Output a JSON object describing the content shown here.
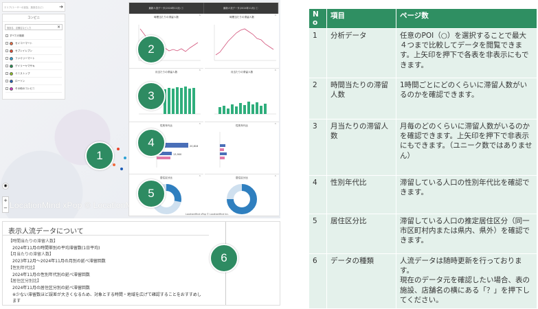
{
  "left": {
    "search_placeholder": "エリア(ユーザーの追加、施設名など)",
    "filter": {
      "title": "コンビニ",
      "search_placeholder": "施設名、店舗名など入力",
      "items": [
        {
          "label": "すべての施設",
          "color": "#ffffff"
        },
        {
          "label": "セイコーマート",
          "color": "#f06a3c"
        },
        {
          "label": "セブンイレブン",
          "color": "#e8452c"
        },
        {
          "label": "ファミリーマート",
          "color": "#2aa1d4"
        },
        {
          "label": "デイリーヤマザキ",
          "color": "#1f8f4b"
        },
        {
          "label": "ミニストップ",
          "color": "#8fc31f"
        },
        {
          "label": "ローソン",
          "color": "#1b5bb5"
        },
        {
          "label": "その他のコンビニ",
          "color": "#d633c8"
        }
      ]
    },
    "watermark": "LocationMind xPop © LocationMind Inc.",
    "credit": "LocationMind xPop © LocationMind Inc.",
    "dashboard": {
      "tabs": [
        "最新人流データ(2024年11月) ⓘ",
        "最新人流データ(2024年11月) ⓘ"
      ],
      "panels": [
        {
          "title": "時間当たりの滞留人数"
        },
        {
          "title": "時間当たりの滞留人数"
        },
        {
          "title": "月当たりの滞留人数"
        },
        {
          "title": "月当たりの滞留人数"
        },
        {
          "title": "性別年代比"
        },
        {
          "title": "性別年代比"
        },
        {
          "title": "居住区分比"
        },
        {
          "title": "居住区分比"
        }
      ],
      "bar_values": [
        "20,818",
        "13,900"
      ]
    },
    "badges": [
      "1",
      "2",
      "3",
      "4",
      "5",
      "6"
    ],
    "note": {
      "title": "表示人流データについて",
      "lines": [
        {
          "text": "【時間当たりの滞留人数】",
          "strong": true
        },
        {
          "text": "2024年11月の時間帯別の平均滞留数(1日平均)",
          "strong": false
        },
        {
          "text": "【月当たりの滞留人数】",
          "strong": true
        },
        {
          "text": "2023年12月～2024年11月の月別の延べ滞留回数",
          "strong": false
        },
        {
          "text": "【性別年代比】",
          "strong": true
        },
        {
          "text": "2024年11月の性別年代別の延べ滞留回数",
          "strong": false
        },
        {
          "text": "【居住区分別比】",
          "strong": true
        },
        {
          "text": "2024年11月の居住区分別の延べ滞留回数",
          "strong": false
        },
        {
          "text": "※少ない滞留数ほど誤差が大きくなるため、対象とする時間・地域を広げて確認することをおすすめします",
          "strong": false
        }
      ]
    }
  },
  "table": {
    "headers": [
      "N\no",
      "項目",
      "ページ数"
    ],
    "rows": [
      {
        "no": "1",
        "item": "分析データ",
        "desc": "任意のPOI（○）を選択することで最大４つまで比較してデータを閲覧できます。上矢印を押下で各表を非表示にもできます。"
      },
      {
        "no": "2",
        "item": "時間当たりの滞留人数",
        "desc": "1時間ごとにどのくらいに滞留人数がいるのかを確認できます。"
      },
      {
        "no": "3",
        "item": "月当たりの滞留人数",
        "desc": "月毎のどのくらいに滞留人数がいるのかを確認できます。上矢印を押下で非表示にもできます。（ユニーク数ではありません）"
      },
      {
        "no": "4",
        "item": "性別年代比",
        "desc": "滞留している人口の性別年代比を確認できます。"
      },
      {
        "no": "5",
        "item": "居住区分比",
        "desc": "滞留している人口の推定居住区分（同一市区町村内または県内、県外）を確認できます。"
      },
      {
        "no": "6",
        "item": "データの種類",
        "desc": "人流データは随時更新を行っております。\n現在のデータ元を確認したい場合、表の施設、店舗名の横にある「？」を押下してください。"
      }
    ]
  },
  "colors": {
    "accent": "#2f8f62",
    "cell": "#e4f1eb",
    "line": "#d2527a",
    "bar": "#2fae7c",
    "hbar": "#4a6fb8",
    "pie": "#2f7fbf"
  }
}
